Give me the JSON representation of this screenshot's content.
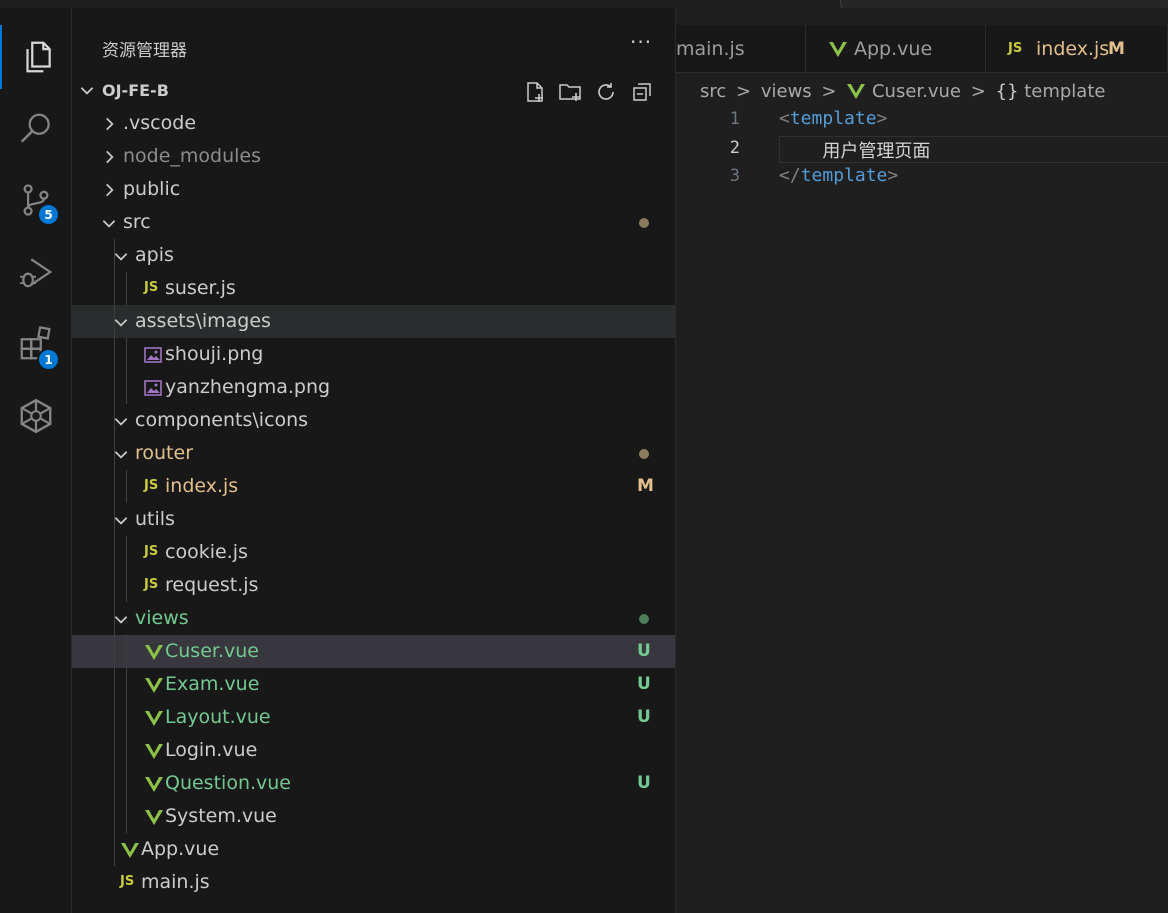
{
  "explorer": {
    "title": "资源管理器",
    "more": "···",
    "project": "OJ-FE-B"
  },
  "activity": {
    "source_control_badge": "5",
    "extensions_badge": "1"
  },
  "tree": [
    {
      "label": ".vscode",
      "kind": "folder",
      "expanded": false,
      "color": "#cccccc"
    },
    {
      "label": "node_modules",
      "kind": "folder",
      "expanded": false,
      "color": "#8c8c8c"
    },
    {
      "label": "public",
      "kind": "folder",
      "expanded": false,
      "color": "#cccccc"
    },
    {
      "label": "src",
      "kind": "folder",
      "expanded": true,
      "color": "#cccccc",
      "decoration": "dot",
      "deco_color": "#8a7b5c"
    },
    {
      "label": "apis",
      "kind": "folder",
      "expanded": true,
      "color": "#cccccc"
    },
    {
      "label": "suser.js",
      "kind": "js",
      "color": "#cccccc"
    },
    {
      "label": "assets\\images",
      "kind": "folder",
      "expanded": true,
      "color": "#cccccc"
    },
    {
      "label": "shouji.png",
      "kind": "image",
      "color": "#cccccc"
    },
    {
      "label": "yanzhengma.png",
      "kind": "image",
      "color": "#cccccc"
    },
    {
      "label": "components\\icons",
      "kind": "folder",
      "expanded": true,
      "color": "#cccccc"
    },
    {
      "label": "router",
      "kind": "folder",
      "expanded": true,
      "color": "#e2c08d",
      "decoration": "dot",
      "deco_color": "#8a7b5c"
    },
    {
      "label": "index.js",
      "kind": "js",
      "color": "#e2c08d",
      "decoration": "M",
      "deco_color": "#e2c08d"
    },
    {
      "label": "utils",
      "kind": "folder",
      "expanded": true,
      "color": "#cccccc"
    },
    {
      "label": "cookie.js",
      "kind": "js",
      "color": "#cccccc"
    },
    {
      "label": "request.js",
      "kind": "js",
      "color": "#cccccc"
    },
    {
      "label": "views",
      "kind": "folder",
      "expanded": true,
      "color": "#73c991",
      "decoration": "dot",
      "deco_color": "#4f7d5a"
    },
    {
      "label": "Cuser.vue",
      "kind": "vue",
      "color": "#73c991",
      "decoration": "U",
      "deco_color": "#73c991"
    },
    {
      "label": "Exam.vue",
      "kind": "vue",
      "color": "#73c991",
      "decoration": "U",
      "deco_color": "#73c991"
    },
    {
      "label": "Layout.vue",
      "kind": "vue",
      "color": "#73c991",
      "decoration": "U",
      "deco_color": "#73c991"
    },
    {
      "label": "Login.vue",
      "kind": "vue",
      "color": "#cccccc"
    },
    {
      "label": "Question.vue",
      "kind": "vue",
      "color": "#73c991",
      "decoration": "U",
      "deco_color": "#73c991"
    },
    {
      "label": "System.vue",
      "kind": "vue",
      "color": "#cccccc"
    },
    {
      "label": "App.vue",
      "kind": "vue",
      "color": "#cccccc"
    },
    {
      "label": "main.js",
      "kind": "js",
      "color": "#cccccc"
    }
  ],
  "icon_labels": {
    "js": "JS"
  },
  "tabs": [
    {
      "label": "main.js",
      "color": "#9d9d9d"
    },
    {
      "label": "App.vue",
      "color": "#9d9d9d"
    },
    {
      "label": "index.js",
      "color": "#e2c08d",
      "decoration": "M"
    }
  ],
  "breadcrumb": {
    "parts": [
      "src",
      "views",
      "Cuser.vue",
      "template"
    ],
    "separator": ">",
    "template_icon": "{}"
  },
  "code_lines": [
    {
      "number": "1",
      "text": "<template>"
    },
    {
      "number": "2",
      "text": "    用户管理页面"
    },
    {
      "number": "3",
      "text": "</template>"
    }
  ],
  "colors": {
    "accent": "#0078d4",
    "vue": "#8dc149",
    "js": "#cbcb41",
    "tag": "#569cd6",
    "bracket": "#808080"
  }
}
